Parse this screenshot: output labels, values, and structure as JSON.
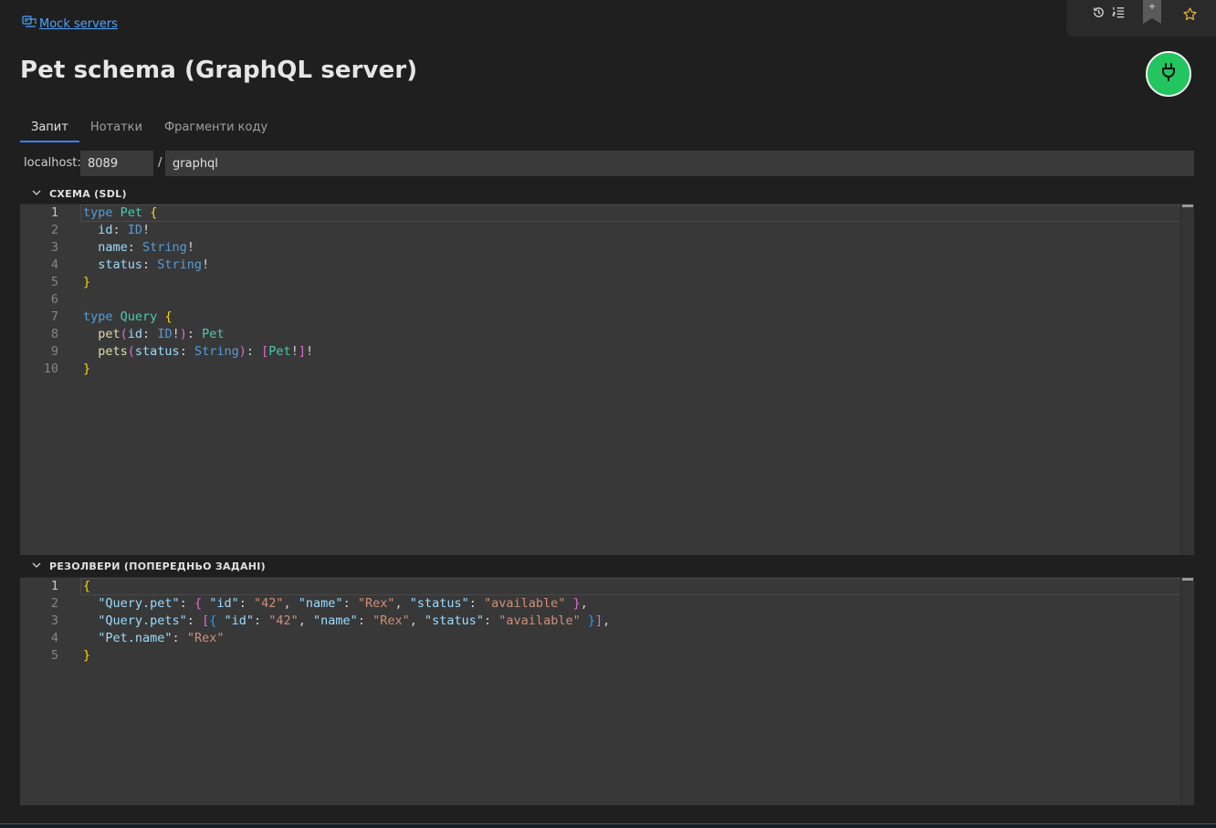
{
  "breadcrumb": {
    "label": "Mock servers",
    "icon": "mock-server-icon"
  },
  "page": {
    "title": "Pet schema (GraphQL server)"
  },
  "toolbar": {
    "icons": [
      "history-icon",
      "list-icon",
      "bookmark-add-icon",
      "star-icon"
    ],
    "start_button_icon": "plug-icon",
    "start_button_color": "#22c55e"
  },
  "tabs": [
    {
      "label": "Запит",
      "active": true
    },
    {
      "label": "Нотатки",
      "active": false
    },
    {
      "label": "Фрагменти коду",
      "active": false
    }
  ],
  "url": {
    "host_label": "localhost:",
    "port": "8089",
    "separator": "/",
    "path": "graphql"
  },
  "schema_section": {
    "title": "СХЕМА (SDL)",
    "line_numbers": [
      "1",
      "2",
      "3",
      "4",
      "5",
      "6",
      "7",
      "8",
      "9",
      "10"
    ],
    "lines": [
      [
        {
          "t": "type",
          "c": "kw"
        },
        {
          "t": " ",
          "c": "txt"
        },
        {
          "t": "Pet",
          "c": "ty"
        },
        {
          "t": " ",
          "c": "txt"
        },
        {
          "t": "{",
          "c": "br1"
        }
      ],
      [
        {
          "t": "  id",
          "c": "pr"
        },
        {
          "t": ": ",
          "c": "txt"
        },
        {
          "t": "ID",
          "c": "kw"
        },
        {
          "t": "!",
          "c": "txt"
        }
      ],
      [
        {
          "t": "  name",
          "c": "pr"
        },
        {
          "t": ": ",
          "c": "txt"
        },
        {
          "t": "String",
          "c": "kw"
        },
        {
          "t": "!",
          "c": "txt"
        }
      ],
      [
        {
          "t": "  status",
          "c": "pr"
        },
        {
          "t": ": ",
          "c": "txt"
        },
        {
          "t": "String",
          "c": "kw"
        },
        {
          "t": "!",
          "c": "txt"
        }
      ],
      [
        {
          "t": "}",
          "c": "br1"
        }
      ],
      [],
      [
        {
          "t": "type",
          "c": "kw"
        },
        {
          "t": " ",
          "c": "txt"
        },
        {
          "t": "Query",
          "c": "ty"
        },
        {
          "t": " ",
          "c": "txt"
        },
        {
          "t": "{",
          "c": "br1"
        }
      ],
      [
        {
          "t": "  pet",
          "c": "fn"
        },
        {
          "t": "(",
          "c": "br2"
        },
        {
          "t": "id",
          "c": "pr"
        },
        {
          "t": ": ",
          "c": "txt"
        },
        {
          "t": "ID",
          "c": "kw"
        },
        {
          "t": "!",
          "c": "txt"
        },
        {
          "t": ")",
          "c": "br2"
        },
        {
          "t": ": ",
          "c": "txt"
        },
        {
          "t": "Pet",
          "c": "ty"
        }
      ],
      [
        {
          "t": "  pets",
          "c": "fn"
        },
        {
          "t": "(",
          "c": "br2"
        },
        {
          "t": "status",
          "c": "pr"
        },
        {
          "t": ": ",
          "c": "txt"
        },
        {
          "t": "String",
          "c": "kw"
        },
        {
          "t": ")",
          "c": "br2"
        },
        {
          "t": ": ",
          "c": "txt"
        },
        {
          "t": "[",
          "c": "br2"
        },
        {
          "t": "Pet",
          "c": "ty"
        },
        {
          "t": "!",
          "c": "txt"
        },
        {
          "t": "]",
          "c": "br2"
        },
        {
          "t": "!",
          "c": "txt"
        }
      ],
      [
        {
          "t": "}",
          "c": "br1"
        }
      ]
    ]
  },
  "resolvers_section": {
    "title": "РЕЗОЛВЕРИ (ПОПЕРЕДНЬО ЗАДАНІ)",
    "line_numbers": [
      "1",
      "2",
      "3",
      "4",
      "5"
    ],
    "lines": [
      [
        {
          "t": "{",
          "c": "br1"
        }
      ],
      [
        {
          "t": "  \"Query.pet\"",
          "c": "key"
        },
        {
          "t": ": ",
          "c": "txt"
        },
        {
          "t": "{",
          "c": "br2"
        },
        {
          "t": " ",
          "c": "txt"
        },
        {
          "t": "\"id\"",
          "c": "key"
        },
        {
          "t": ": ",
          "c": "txt"
        },
        {
          "t": "\"42\"",
          "c": "str"
        },
        {
          "t": ", ",
          "c": "txt"
        },
        {
          "t": "\"name\"",
          "c": "key"
        },
        {
          "t": ": ",
          "c": "txt"
        },
        {
          "t": "\"Rex\"",
          "c": "str"
        },
        {
          "t": ", ",
          "c": "txt"
        },
        {
          "t": "\"status\"",
          "c": "key"
        },
        {
          "t": ": ",
          "c": "txt"
        },
        {
          "t": "\"available\"",
          "c": "str"
        },
        {
          "t": " ",
          "c": "txt"
        },
        {
          "t": "}",
          "c": "br2"
        },
        {
          "t": ",",
          "c": "txt"
        }
      ],
      [
        {
          "t": "  \"Query.pets\"",
          "c": "key"
        },
        {
          "t": ": ",
          "c": "txt"
        },
        {
          "t": "[",
          "c": "br2"
        },
        {
          "t": "{",
          "c": "br3"
        },
        {
          "t": " ",
          "c": "txt"
        },
        {
          "t": "\"id\"",
          "c": "key"
        },
        {
          "t": ": ",
          "c": "txt"
        },
        {
          "t": "\"42\"",
          "c": "str"
        },
        {
          "t": ", ",
          "c": "txt"
        },
        {
          "t": "\"name\"",
          "c": "key"
        },
        {
          "t": ": ",
          "c": "txt"
        },
        {
          "t": "\"Rex\"",
          "c": "str"
        },
        {
          "t": ", ",
          "c": "txt"
        },
        {
          "t": "\"status\"",
          "c": "key"
        },
        {
          "t": ": ",
          "c": "txt"
        },
        {
          "t": "\"available\"",
          "c": "str"
        },
        {
          "t": " ",
          "c": "txt"
        },
        {
          "t": "}",
          "c": "br3"
        },
        {
          "t": "]",
          "c": "br2"
        },
        {
          "t": ",",
          "c": "txt"
        }
      ],
      [
        {
          "t": "  \"Pet.name\"",
          "c": "key"
        },
        {
          "t": ": ",
          "c": "txt"
        },
        {
          "t": "\"Rex\"",
          "c": "str"
        }
      ],
      [
        {
          "t": "}",
          "c": "br1"
        }
      ]
    ]
  }
}
